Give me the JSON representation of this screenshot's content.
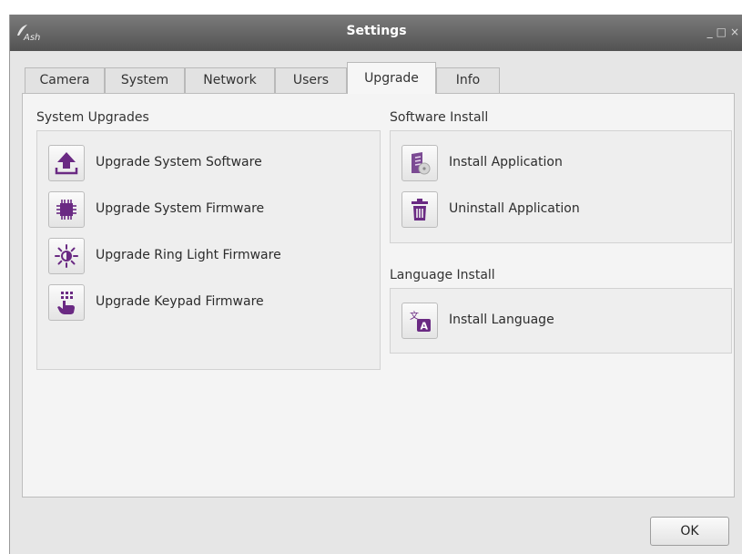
{
  "window": {
    "title": "Settings",
    "app_logo_text": "Ash"
  },
  "tabs": [
    {
      "label": "Camera"
    },
    {
      "label": "System"
    },
    {
      "label": "Network"
    },
    {
      "label": "Users"
    },
    {
      "label": "Upgrade",
      "active": true
    },
    {
      "label": "Info"
    }
  ],
  "system_upgrades": {
    "title": "System Upgrades",
    "items": [
      {
        "label": "Upgrade System Software",
        "icon": "upload-icon"
      },
      {
        "label": "Upgrade System Firmware",
        "icon": "chip-icon"
      },
      {
        "label": "Upgrade Ring Light Firmware",
        "icon": "ring-light-icon"
      },
      {
        "label": "Upgrade Keypad Firmware",
        "icon": "keypad-touch-icon"
      }
    ]
  },
  "software_install": {
    "title": "Software Install",
    "items": [
      {
        "label": "Install Application",
        "icon": "install-package-icon"
      },
      {
        "label": "Uninstall Application",
        "icon": "trash-icon"
      }
    ]
  },
  "language_install": {
    "title": "Language Install",
    "items": [
      {
        "label": "Install Language",
        "icon": "translate-icon",
        "icon_text": "A"
      }
    ]
  },
  "footer": {
    "ok_label": "OK"
  },
  "colors": {
    "accent": "#6a2a83",
    "titlebar": "#5f5f5f"
  }
}
